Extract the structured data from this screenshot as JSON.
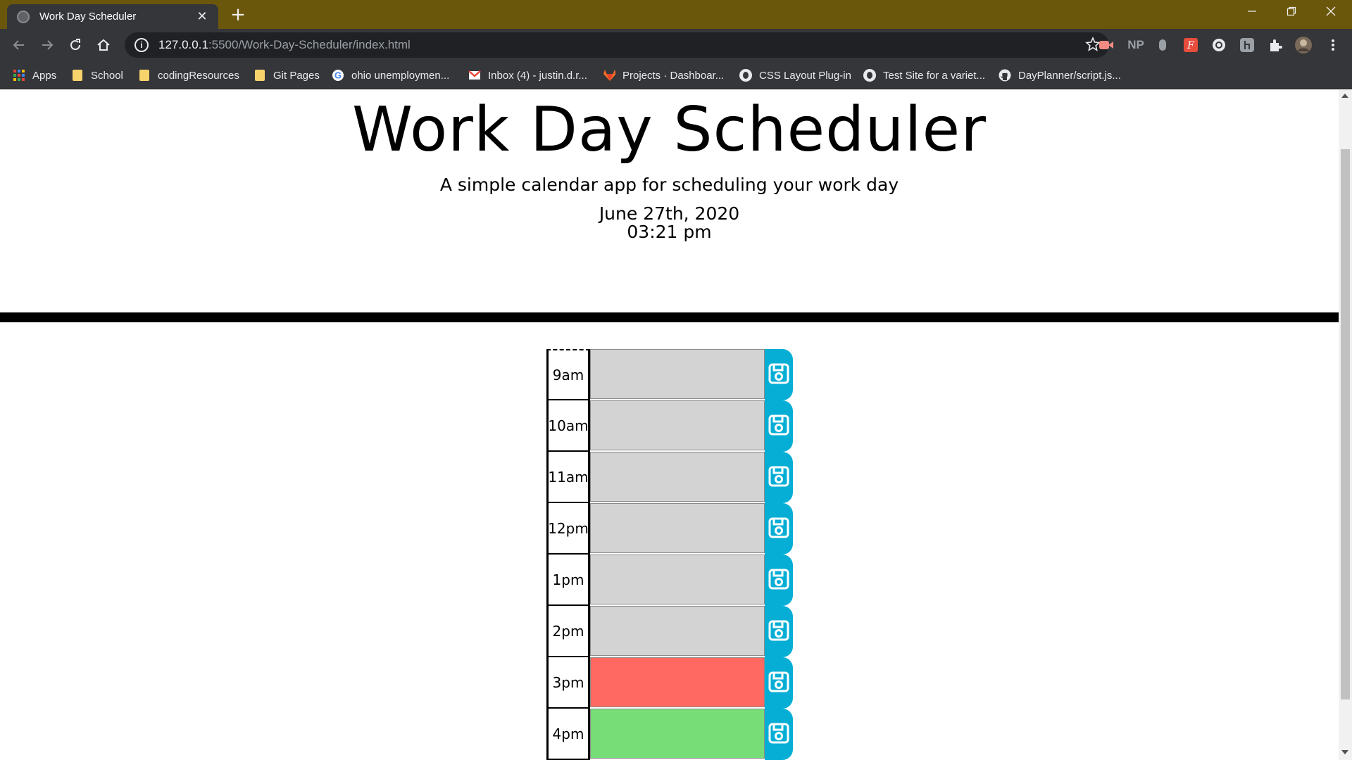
{
  "browser": {
    "tab_title": "Work Day Scheduler",
    "url_host": "127.0.0.1",
    "url_path": ":5500/Work-Day-Scheduler/index.html",
    "accent_color": "#6b570b",
    "np_label": "NP",
    "bookmarks": [
      {
        "label": "Apps",
        "icon": "apps-grid-icon"
      },
      {
        "label": "School",
        "icon": "folder-icon"
      },
      {
        "label": "codingResources",
        "icon": "folder-icon"
      },
      {
        "label": "Git Pages",
        "icon": "folder-icon"
      },
      {
        "label": "ohio unemploymen...",
        "icon": "google-icon"
      },
      {
        "label": "Inbox (4) - justin.d.r...",
        "icon": "gmail-icon"
      },
      {
        "label": "Projects · Dashboar...",
        "icon": "gitlab-icon"
      },
      {
        "label": "CSS Layout Plug-in",
        "icon": "globe-icon"
      },
      {
        "label": "Test Site for a variet...",
        "icon": "globe-icon"
      },
      {
        "label": "DayPlanner/script.js...",
        "icon": "github-icon"
      }
    ]
  },
  "page": {
    "title": "Work Day Scheduler",
    "lead": "A simple calendar app for scheduling your work day",
    "date": "June 27th, 2020",
    "time": "03:21 pm"
  },
  "schedule": {
    "rows": [
      {
        "hour": "9am",
        "status": "past",
        "text": ""
      },
      {
        "hour": "10am",
        "status": "past",
        "text": ""
      },
      {
        "hour": "11am",
        "status": "past",
        "text": ""
      },
      {
        "hour": "12pm",
        "status": "past",
        "text": ""
      },
      {
        "hour": "1pm",
        "status": "past",
        "text": ""
      },
      {
        "hour": "2pm",
        "status": "past",
        "text": ""
      },
      {
        "hour": "3pm",
        "status": "present",
        "text": ""
      },
      {
        "hour": "4pm",
        "status": "future",
        "text": ""
      }
    ],
    "colors": {
      "past": "#d3d3d3",
      "present": "#ff6961",
      "future": "#77dd77",
      "save_button": "#06aed5"
    }
  }
}
